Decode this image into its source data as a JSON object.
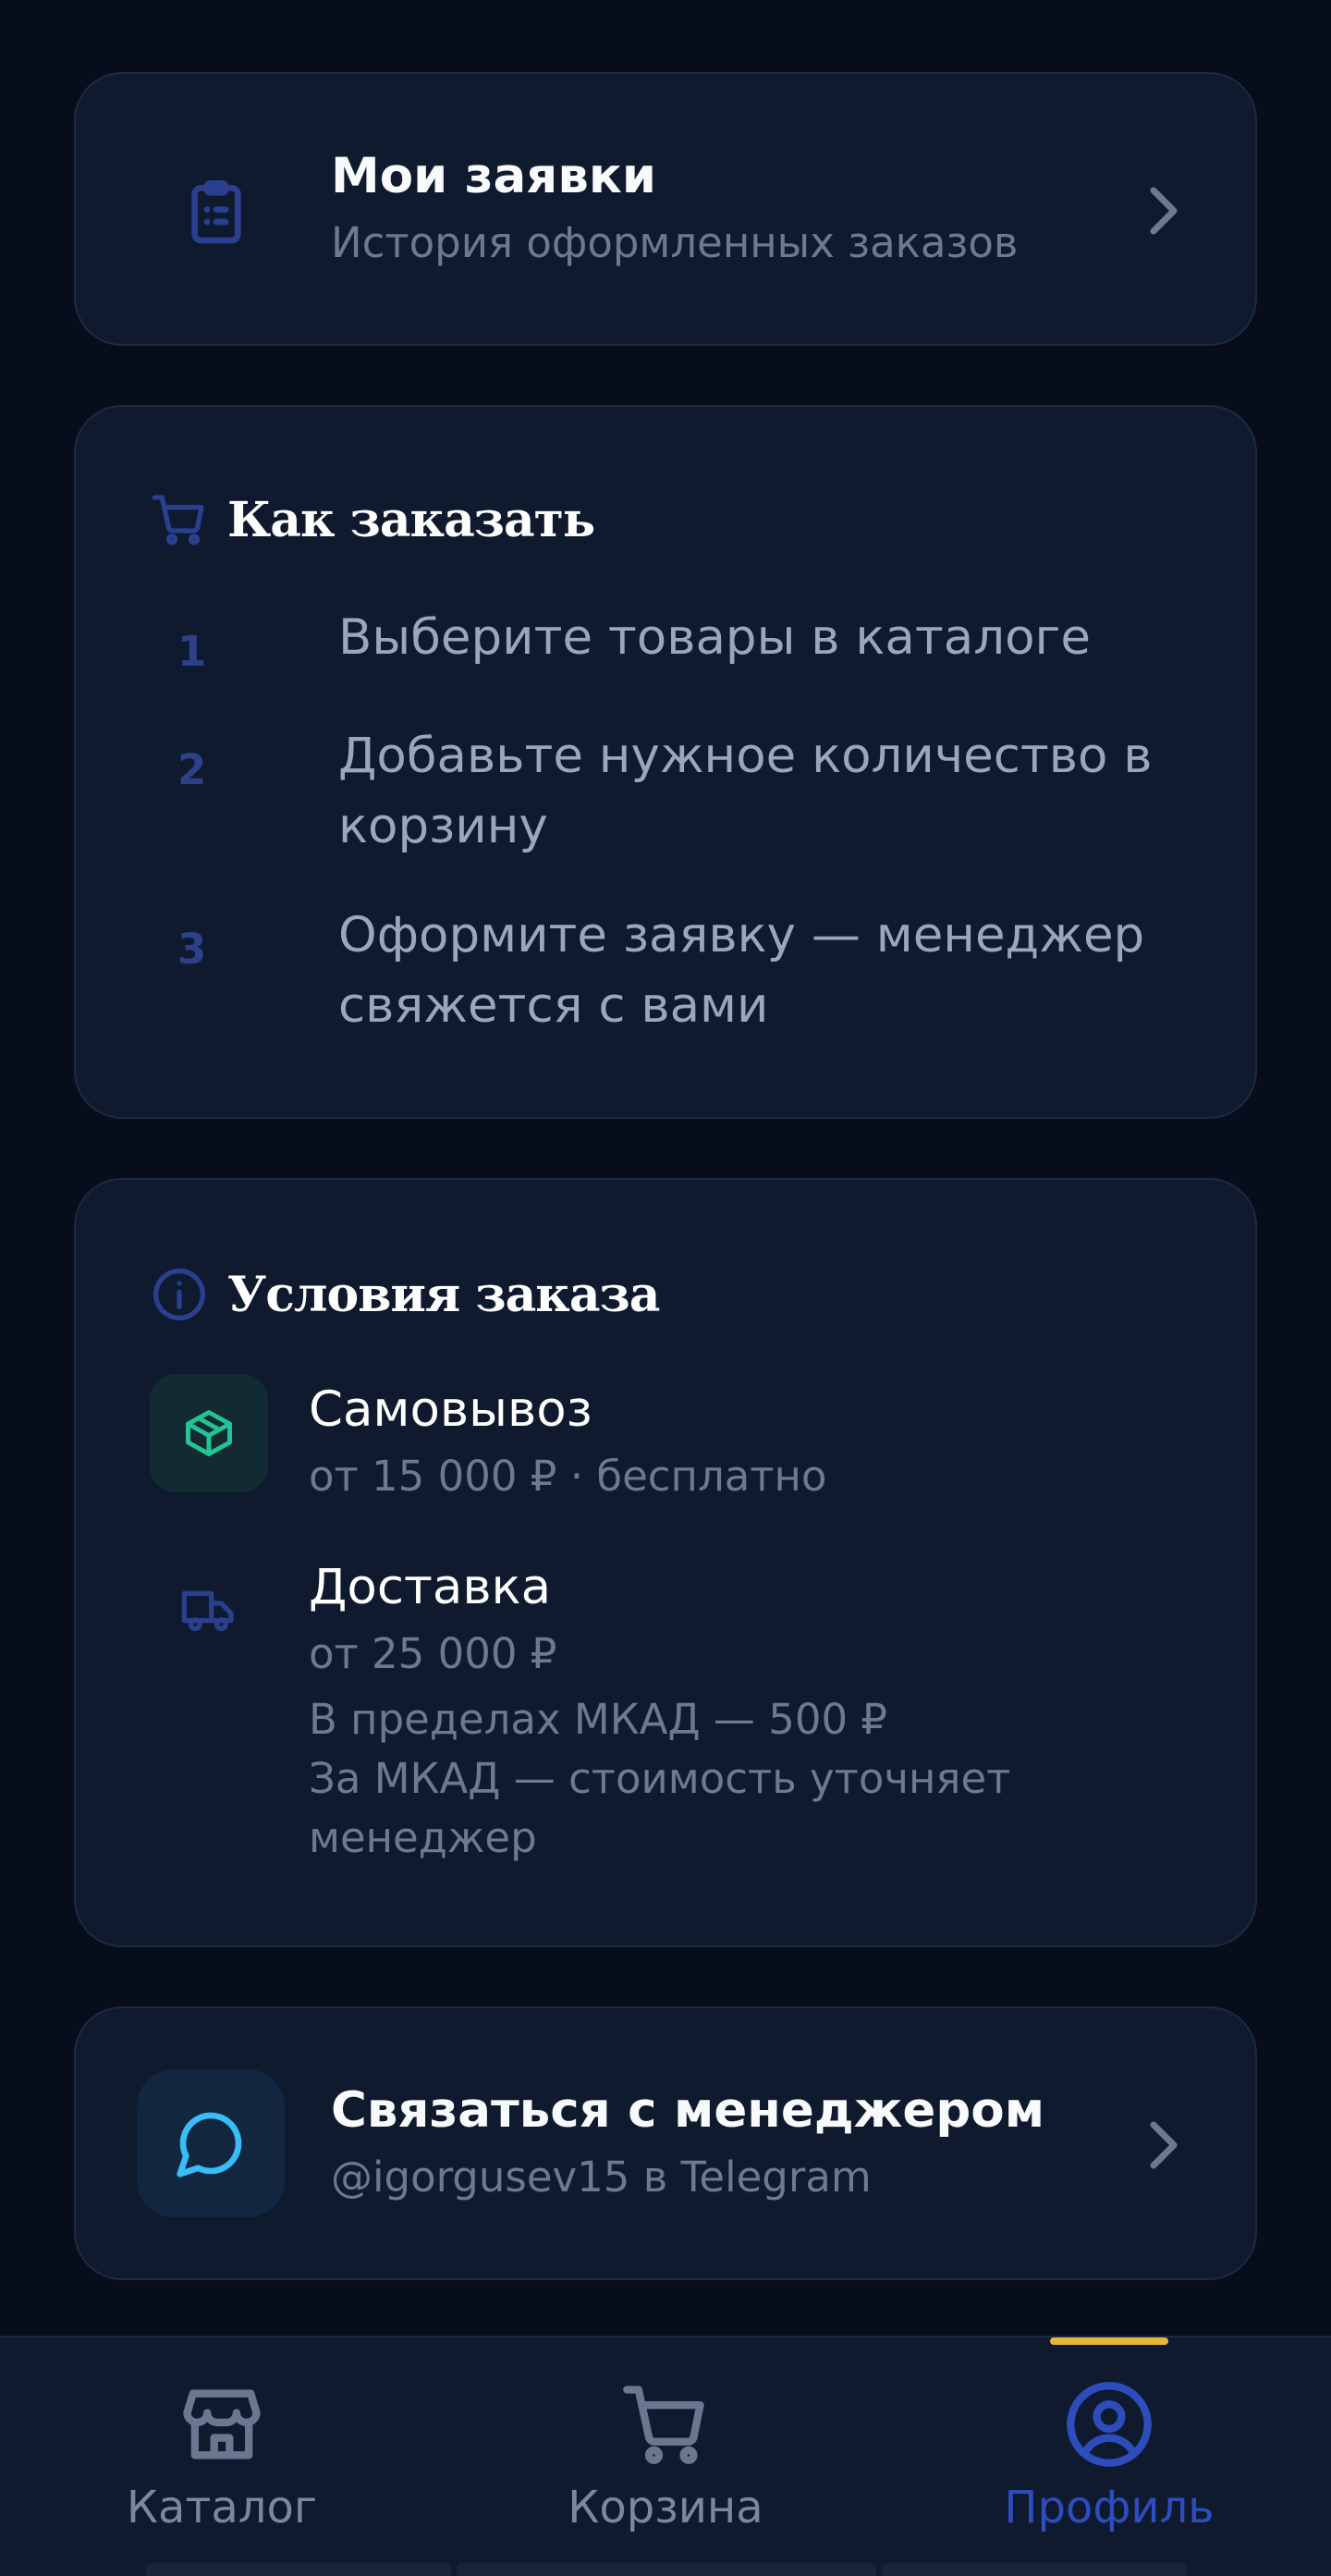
{
  "orders": {
    "title": "Мои заявки",
    "subtitle": "История оформленных заказов",
    "icon": "clipboard-list-icon"
  },
  "how_to_order": {
    "title": "Как заказать",
    "icon": "cart-icon",
    "steps": [
      {
        "num": "1",
        "text": "Выберите товары в каталоге"
      },
      {
        "num": "2",
        "text": "Добавьте нужное количество в корзину"
      },
      {
        "num": "3",
        "text": "Оформите заявку — менеджер свяжется с вами"
      }
    ]
  },
  "conditions": {
    "title": "Условия заказа",
    "icon": "info-icon",
    "pickup": {
      "title": "Самовывоз",
      "subtitle": "от 15 000 ₽ · бесплатно",
      "icon": "package-icon"
    },
    "delivery": {
      "title": "Доставка",
      "subtitle": "от 25 000 ₽",
      "note_1": "В пределах МКАД — 500 ₽",
      "note_2": "За МКАД — стоимость уточняет менеджер",
      "icon": "truck-icon"
    }
  },
  "manager": {
    "title": "Связаться с менеджером",
    "subtitle": "@igorgusev15 в Telegram",
    "icon": "chat-bubble-icon"
  },
  "nav": {
    "items": [
      {
        "label": "Каталог",
        "icon": "store-icon",
        "active": false
      },
      {
        "label": "Корзина",
        "icon": "cart-icon",
        "active": false
      },
      {
        "label": "Профиль",
        "icon": "user-circle-icon",
        "active": true
      }
    ]
  },
  "colors": {
    "background": "#070d1a",
    "card": "#0f1a2e",
    "accent_blue": "#2e4dbd",
    "accent_green": "#22c493",
    "accent_cyan": "#38bdf8",
    "indicator_gold": "#e8b53a"
  }
}
